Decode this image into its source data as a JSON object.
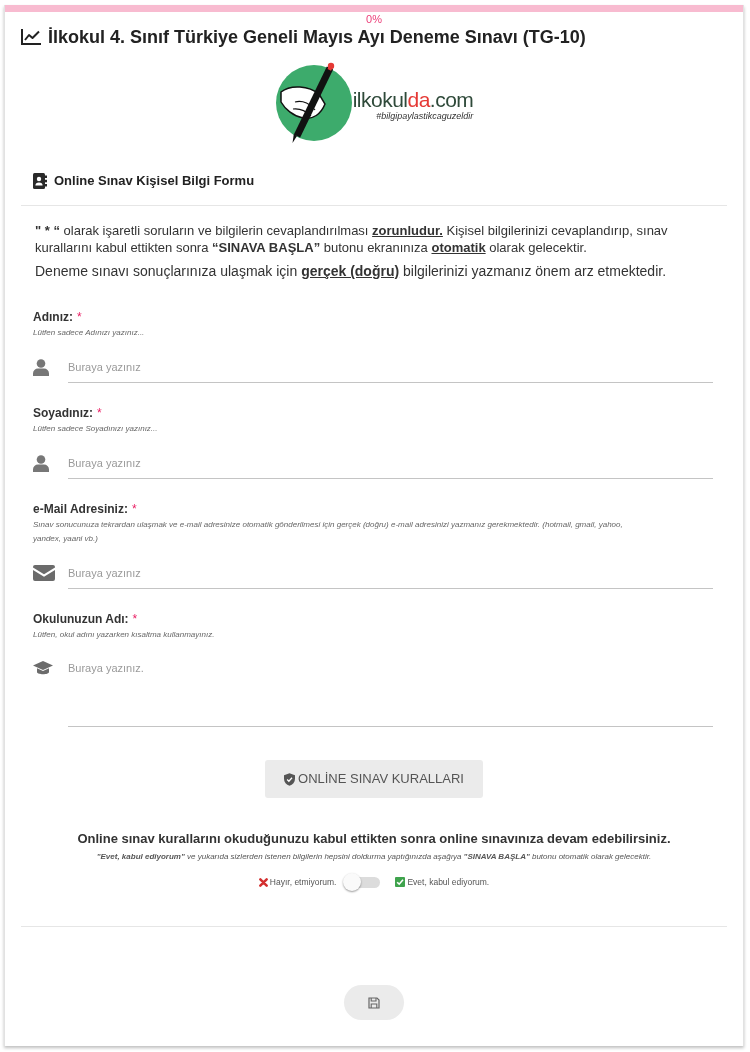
{
  "progress": {
    "level": 0,
    "reading": "0%"
  },
  "title": "İlkokul 4. Sınıf Türkiye Geneli Mayıs Ayı Deneme Sınavı (TG-10)",
  "logo": {
    "wordmark": [
      {
        "text": "ilkokul",
        "accent": false
      },
      {
        "text": "da",
        "accent": true
      },
      {
        "text": ".com",
        "accent": false
      }
    ],
    "tagline": "#bilgipaylastikcaguzeldir"
  },
  "form_header": "Online Sınav Kişisel Bilgi Formu",
  "intro": [
    [
      {
        "kind": "strong",
        "text": "\" * “"
      },
      {
        "kind": "plain",
        "text": " olarak işaretli soruların ve bilgilerin cevaplandırılması "
      },
      {
        "kind": "emphasis",
        "text": "zorunludur."
      },
      {
        "kind": "plain",
        "text": " Kişisel bilgilerinizi cevaplandırıp, sınav kurallarını kabul ettikten sonra "
      },
      {
        "kind": "strong",
        "text": "“SINAVA BAŞLA”"
      },
      {
        "kind": "plain",
        "text": " butonu ekranınıza "
      },
      {
        "kind": "emphasis",
        "text": "otomatik"
      },
      {
        "kind": "plain",
        "text": " olarak gelecektir."
      }
    ],
    [
      {
        "kind": "plain",
        "text": "Deneme sınavı sonuçlarınıza ulaşmak için "
      },
      {
        "kind": "emphasis",
        "text": "gerçek (doğru)"
      },
      {
        "kind": "plain",
        "text": " bilgilerinizi yazmanız önem arz etmektedir."
      }
    ]
  ],
  "fields": [
    {
      "kind": "text",
      "label": "Adınız:",
      "required_mark": "*",
      "hint": "Lütfen sadece Adınızı yazınız...",
      "placeholder": "Buraya yazınız"
    },
    {
      "kind": "text",
      "label": "Soyadınız:",
      "required_mark": "*",
      "hint": "Lütfen sadece Soyadınızı yazınız...",
      "placeholder": "Buraya yazınız"
    },
    {
      "kind": "email",
      "label": "e-Mail Adresiniz:",
      "required_mark": "*",
      "hint": "Sınav sonucunuza tekrardan ulaşmak ve e-mail adresinize otomatik gönderilmesi için gerçek (doğru) e-mail adresinizi yazmanız gerekmektedir. (hotmail, gmail, yahoo, yandex, yaani vb.)",
      "placeholder": "Buraya yazınız"
    },
    {
      "kind": "multiline",
      "label": "Okulunuzun Adı:",
      "required_mark": "*",
      "hint": "Lütfen, okul adını yazarken kısaltma kullanmayınız.",
      "placeholder": "Buraya yazınız."
    }
  ],
  "rules_button": "ONLİNE SINAV KURALLARI",
  "consent": {
    "heading": "Online sınav kurallarını okuduğunuzu kabul ettikten sonra online sınavınıza devam edebilirsiniz.",
    "note": "**\"Evet, kabul ediyorum\"** ve yukarıda sizlerden istenen bilgilerin hepsini doldurma yaptığınızda aşağıya **\"SINAVA BAŞLA\"** butonu otomatik olarak gelecektir.",
    "decline": "Hayır, etmiyorum.",
    "accept": "Evet, kabul ediyorum.",
    "on": false
  }
}
